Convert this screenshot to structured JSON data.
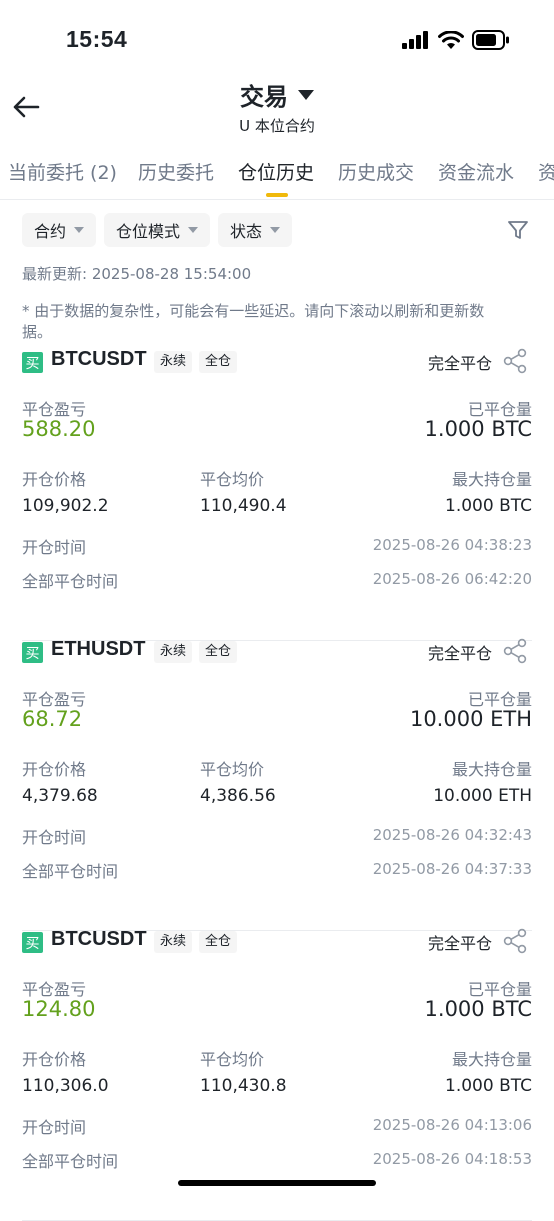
{
  "status_bar": {
    "time": "15:54"
  },
  "header": {
    "title": "交易",
    "subtitle": "U 本位合约"
  },
  "tabs": [
    "当前委托 (2)",
    "历史委托",
    "仓位历史",
    "历史成交",
    "资金流水",
    "资"
  ],
  "filters": [
    "合约",
    "仓位模式",
    "状态"
  ],
  "last_updated": "最新更新: 2025-08-28 15:54:00",
  "notice": "* 由于数据的复杂性，可能会有一些延迟。请向下滚动以刷新和更新数据。",
  "labels": {
    "realized_pnl": "平仓盈亏",
    "closed_qty": "已平仓量",
    "open_price": "开仓价格",
    "avg_close_price": "平仓均价",
    "max_qty": "最大持仓量",
    "open_time": "开仓时间",
    "close_time": "全部平仓时间"
  },
  "positions": [
    {
      "side": "买",
      "symbol": "BTCUSDT",
      "type": "永续",
      "margin": "全仓",
      "status": "完全平仓",
      "pnl": "588.20",
      "closed_qty": "1.000 BTC",
      "open_price": "109,902.2",
      "avg_close_price": "110,490.4",
      "max_qty": "1.000 BTC",
      "open_time": "2025-08-26 04:38:23",
      "close_time": "2025-08-26 06:42:20"
    },
    {
      "side": "买",
      "symbol": "ETHUSDT",
      "type": "永续",
      "margin": "全仓",
      "status": "完全平仓",
      "pnl": "68.72",
      "closed_qty": "10.000 ETH",
      "open_price": "4,379.68",
      "avg_close_price": "4,386.56",
      "max_qty": "10.000 ETH",
      "open_time": "2025-08-26 04:32:43",
      "close_time": "2025-08-26 04:37:33"
    },
    {
      "side": "买",
      "symbol": "BTCUSDT",
      "type": "永续",
      "margin": "全仓",
      "status": "完全平仓",
      "pnl": "124.80",
      "closed_qty": "1.000 BTC",
      "open_price": "110,306.0",
      "avg_close_price": "110,430.8",
      "max_qty": "1.000 BTC",
      "open_time": "2025-08-26 04:13:06",
      "close_time": "2025-08-26 04:18:53"
    }
  ],
  "colors": {
    "accent": "#f0b90b",
    "buy": "#2ebd85",
    "profit": "#63a11d"
  },
  "icons": [
    "signal-icon",
    "wifi-icon",
    "battery-icon",
    "back-arrow-icon",
    "dropdown-caret-icon",
    "filter-icon",
    "share-icon"
  ]
}
